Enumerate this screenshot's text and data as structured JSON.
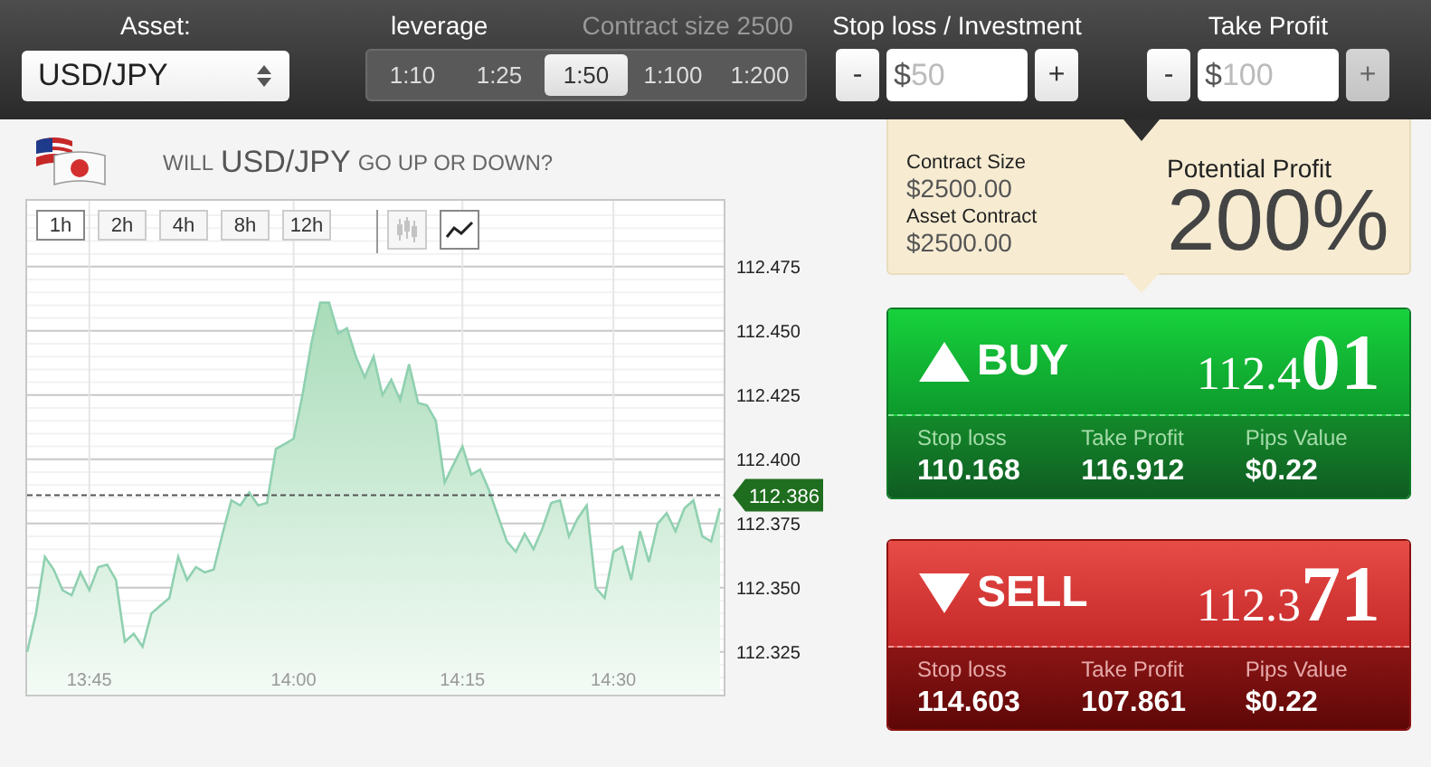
{
  "top_bar": {
    "asset": {
      "label": "Asset:",
      "value": "USD/JPY"
    },
    "leverage": {
      "label": "leverage",
      "contract_size": "Contract size 2500",
      "options": [
        {
          "label": "1:10",
          "selected": false
        },
        {
          "label": "1:25",
          "selected": false
        },
        {
          "label": "1:50",
          "selected": true
        },
        {
          "label": "1:100",
          "selected": false
        },
        {
          "label": "1:200",
          "selected": false
        }
      ]
    },
    "steppers": [
      {
        "label": "Stop loss / Investment",
        "minus": "-",
        "prefix": "$",
        "placeholder": "50",
        "plus": "+",
        "plus_disabled": false
      },
      {
        "label": "Take Profit",
        "minus": "-",
        "prefix": "$",
        "placeholder": "100",
        "plus": "+",
        "plus_disabled": true
      }
    ]
  },
  "question": {
    "prefix": "WILL",
    "asset": "USD/JPY",
    "suffix": "GO UP OR DOWN?"
  },
  "chart": {
    "ranges": [
      {
        "label": "1h",
        "selected": true
      },
      {
        "label": "2h",
        "selected": false
      },
      {
        "label": "4h",
        "selected": false
      },
      {
        "label": "8h",
        "selected": false
      },
      {
        "label": "12h",
        "selected": false
      }
    ],
    "chart_types": [
      {
        "kind": "candlestick",
        "selected": false
      },
      {
        "kind": "line",
        "selected": true
      }
    ],
    "chart_data": {
      "type": "area",
      "categories": [
        null,
        null,
        null,
        null,
        null,
        null,
        null,
        "13:45",
        null,
        null,
        null,
        null,
        null,
        null,
        null,
        null,
        null,
        null,
        null,
        null,
        null,
        null,
        null,
        null,
        null,
        null,
        null,
        null,
        null,
        null,
        "14:00",
        null,
        null,
        null,
        null,
        null,
        null,
        null,
        null,
        null,
        null,
        null,
        null,
        null,
        null,
        null,
        null,
        null,
        null,
        "14:15",
        null,
        null,
        null,
        null,
        null,
        null,
        null,
        null,
        null,
        null,
        null,
        null,
        null,
        null,
        null,
        null,
        "14:30",
        null,
        null,
        null,
        null,
        null,
        null,
        null,
        null,
        null,
        null,
        null,
        null
      ],
      "series": [
        {
          "color": "#8fd0b0",
          "values": [
            112.325,
            112.34,
            112.362,
            112.357,
            112.349,
            112.347,
            112.356,
            112.349,
            112.358,
            112.359,
            112.353,
            112.329,
            112.332,
            112.327,
            112.34,
            112.343,
            112.346,
            112.362,
            112.353,
            112.358,
            112.356,
            112.357,
            112.371,
            112.384,
            112.382,
            112.387,
            112.382,
            112.383,
            112.404,
            112.406,
            112.408,
            112.425,
            112.445,
            112.461,
            112.461,
            112.449,
            112.451,
            112.44,
            112.432,
            112.44,
            112.425,
            112.431,
            112.423,
            112.437,
            112.422,
            112.421,
            112.415,
            112.391,
            112.398,
            112.405,
            112.394,
            112.396,
            112.388,
            112.378,
            112.368,
            112.364,
            112.371,
            112.365,
            112.373,
            112.383,
            112.384,
            112.37,
            112.377,
            112.382,
            112.35,
            112.346,
            112.364,
            112.366,
            112.353,
            112.372,
            112.36,
            112.375,
            112.379,
            112.372,
            112.381,
            112.384,
            112.37,
            112.368,
            112.381
          ]
        }
      ],
      "ylim": [
        112.308,
        112.501
      ],
      "grid": true,
      "yticks": [
        {
          "value": 112.475,
          "label": "112.475"
        },
        {
          "value": 112.45,
          "label": "112.450"
        },
        {
          "value": 112.425,
          "label": "112.425"
        },
        {
          "value": 112.4,
          "label": "112.400"
        },
        {
          "value": 112.375,
          "label": "112.375"
        },
        {
          "value": 112.35,
          "label": "112.350"
        },
        {
          "value": 112.325,
          "label": "112.325"
        }
      ],
      "ref_lines": [
        {
          "axis": "y",
          "value": 112.386
        }
      ],
      "annotations": [
        "112.386"
      ]
    }
  },
  "info": {
    "items": [
      {
        "label": "Contract Size",
        "value": "$2500.00"
      },
      {
        "label": "Asset Contract",
        "value": "$2500.00"
      }
    ],
    "profit_label": "Potential Profit",
    "profit": "200%"
  },
  "trades": [
    {
      "kind": "buy",
      "label": "BUY",
      "price_main": "112.4",
      "price_pips": "01",
      "stats": [
        {
          "label": "Stop loss",
          "value": "110.168"
        },
        {
          "label": "Take Profit",
          "value": "116.912"
        },
        {
          "label": "Pips Value",
          "value": "$0.22"
        }
      ]
    },
    {
      "kind": "sell",
      "label": "SELL",
      "price_main": "112.3",
      "price_pips": "71",
      "stats": [
        {
          "label": "Stop loss",
          "value": "114.603"
        },
        {
          "label": "Take Profit",
          "value": "107.861"
        },
        {
          "label": "Pips Value",
          "value": "$0.22"
        }
      ]
    }
  ]
}
